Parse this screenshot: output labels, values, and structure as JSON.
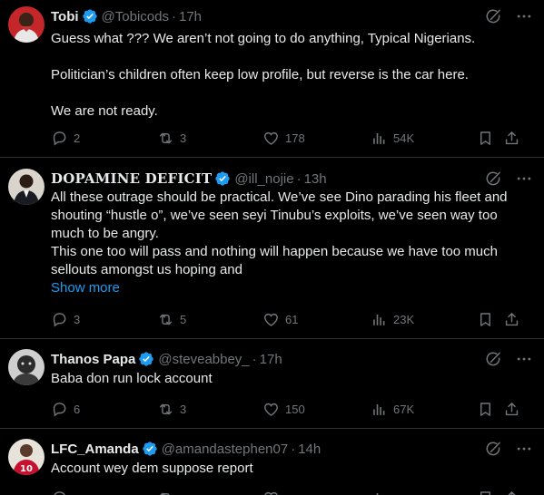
{
  "tweets": [
    {
      "name": "Tobi",
      "handle": "@Tobicods",
      "dot": "·",
      "time": "17h",
      "lines": [
        "Guess what ??? We aren’t not going to do anything, Typical Nigerians.",
        "",
        "Politician’s children often keep low profile, but reverse is the car here.",
        "",
        "We are not ready."
      ],
      "replies": "2",
      "reposts": "3",
      "likes": "178",
      "views": "54K"
    },
    {
      "name": "DOPAMINE DEFICIT",
      "handle": "@ill_nojie",
      "dot": "·",
      "time": "13h",
      "lines": [
        "All these outrage should be practical. We’ve see Dino parading his fleet and",
        "shouting “hustle o”, we’ve seen seyi Tinubu’s exploits, we’ve seen way too",
        "much to be angry.",
        "This one too will pass and nothing will happen because we have too much",
        "sellouts amongst us hoping and"
      ],
      "show_more": "Show more",
      "replies": "3",
      "reposts": "5",
      "likes": "61",
      "views": "23K"
    },
    {
      "name": "Thanos Papa",
      "handle": "@steveabbey_",
      "dot": "·",
      "time": "17h",
      "lines": [
        "Baba don run lock account"
      ],
      "replies": "6",
      "reposts": "3",
      "likes": "150",
      "views": "67K"
    },
    {
      "name": "LFC_Amanda",
      "handle": "@amandastephen07",
      "dot": "·",
      "time": "14h",
      "lines": [
        "Account wey dem suppose report"
      ],
      "replies": "",
      "reposts": "",
      "likes": "",
      "views": ""
    }
  ],
  "colors": {
    "background": "#000000",
    "text": "#e7e9ea",
    "muted": "#71767b",
    "link": "#1d9bf0",
    "verified": "#1d9bf0",
    "divider": "#2f3336"
  },
  "icons": [
    "verified-badge-icon",
    "grok-icon",
    "more-icon",
    "reply-icon",
    "repost-icon",
    "like-icon",
    "views-icon",
    "bookmark-icon",
    "share-icon"
  ]
}
